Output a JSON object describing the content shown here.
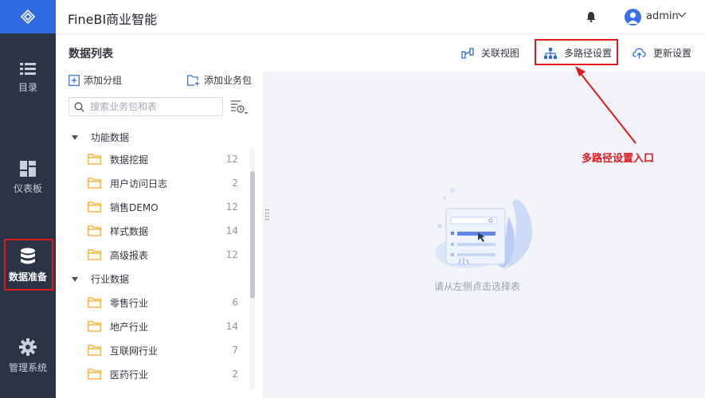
{
  "header": {
    "app_title": "FineBI商业智能",
    "user_name": "admin"
  },
  "nav": {
    "items": [
      {
        "label": "目录",
        "icon": "list-icon"
      },
      {
        "label": "仪表板",
        "icon": "dashboard-icon"
      },
      {
        "label": "数据准备",
        "icon": "database-icon",
        "active": true
      },
      {
        "label": "管理系统",
        "icon": "gear-icon"
      }
    ]
  },
  "toolbar": {
    "title": "数据列表",
    "related_view": "关联视图",
    "multi_path": "多路径设置",
    "update_settings": "更新设置"
  },
  "panel": {
    "add_group": "添加分组",
    "add_package": "添加业务包",
    "search_placeholder": "搜索业务包和表",
    "groups": [
      {
        "name": "功能数据",
        "packages": [
          {
            "name": "数据挖掘",
            "count": "12"
          },
          {
            "name": "用户访问日志",
            "count": "2"
          },
          {
            "name": "销售DEMO",
            "count": "12"
          },
          {
            "name": "样式数据",
            "count": "14"
          },
          {
            "name": "高级报表",
            "count": "12"
          }
        ]
      },
      {
        "name": "行业数据",
        "packages": [
          {
            "name": "零售行业",
            "count": "6"
          },
          {
            "name": "地产行业",
            "count": "14"
          },
          {
            "name": "互联网行业",
            "count": "7"
          },
          {
            "name": "医药行业",
            "count": "2"
          }
        ]
      }
    ]
  },
  "main": {
    "empty_text": "请从左侧点击选择表"
  },
  "annotation": {
    "label": "多路径设置入口",
    "color": "#e0191f"
  },
  "colors": {
    "nav_bg": "#2b3445",
    "logo_bg": "#2f6ae0",
    "accent": "#3e6fe6",
    "folder": "#f5a623"
  }
}
